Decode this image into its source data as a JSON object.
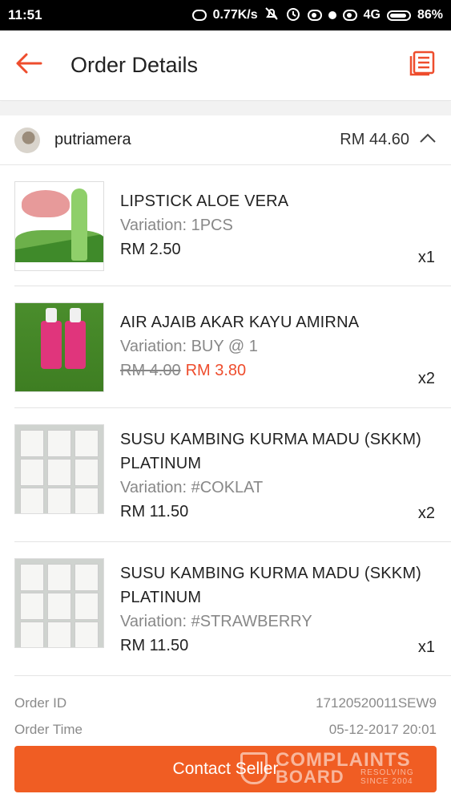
{
  "status_bar": {
    "time": "11:51",
    "net_speed": "0.77K/s",
    "network": "4G",
    "battery": "86%"
  },
  "header": {
    "title": "Order Details",
    "back_icon": "arrow-left-icon",
    "doc_icon": "document-list-icon",
    "accent_color": "#ee4d2d"
  },
  "seller": {
    "name": "putriamera",
    "total": "RM 44.60"
  },
  "items": [
    {
      "name_line1": "LIPSTICK ALOE VERA",
      "name_line2": "",
      "variation": "Variation: 1PCS",
      "price": "RM 2.50",
      "old_price": "",
      "qty": "x1"
    },
    {
      "name_line1": "AIR AJAIB AKAR KAYU AMIRNA",
      "name_line2": "",
      "variation": "Variation: BUY @ 1",
      "price": "RM 3.80",
      "old_price": "RM 4.00",
      "qty": "x2"
    },
    {
      "name_line1": "SUSU KAMBING KURMA MADU (SKKM)",
      "name_line2": "PLATINUM",
      "variation": "Variation: #COKLAT",
      "price": "RM 11.50",
      "old_price": "",
      "qty": "x2"
    },
    {
      "name_line1": "SUSU KAMBING KURMA MADU (SKKM)",
      "name_line2": "PLATINUM",
      "variation": "Variation: #STRAWBERRY",
      "price": "RM 11.50",
      "old_price": "",
      "qty": "x1"
    }
  ],
  "order_info": {
    "order_id_label": "Order ID",
    "order_id_value": "17120520011SEW9",
    "order_time_label": "Order Time",
    "order_time_value": "05-12-2017 20:01"
  },
  "contact_button": {
    "label": "Contact Seller",
    "color": "#f05d23"
  },
  "watermark": {
    "line1": "COMPLAINTS",
    "line2": "BOARD",
    "sub1": "RESOLVING",
    "sub2": "SINCE 2004"
  }
}
